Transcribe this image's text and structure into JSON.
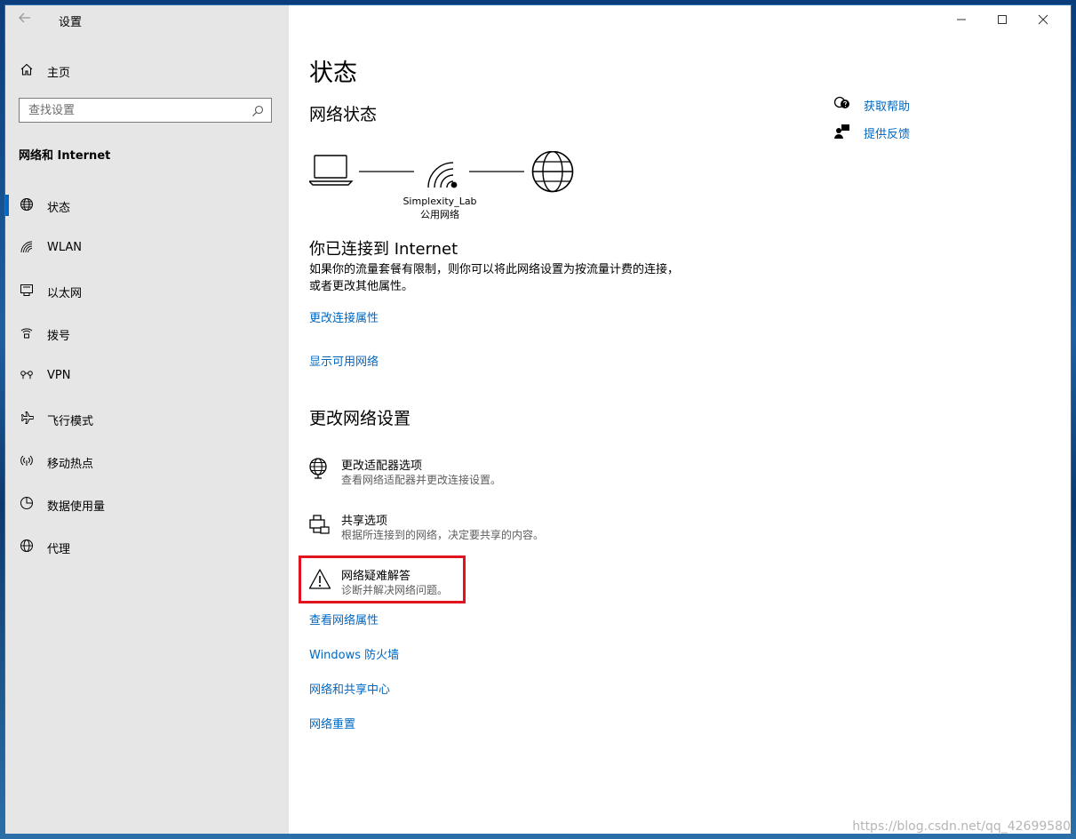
{
  "window": {
    "title": "设置"
  },
  "sidebar": {
    "home_label": "主页",
    "search_placeholder": "查找设置",
    "section_title": "网络和 Internet",
    "items": [
      {
        "label": "状态",
        "icon": "globe-icon",
        "active": true
      },
      {
        "label": "WLAN",
        "icon": "wifi-icon"
      },
      {
        "label": "以太网",
        "icon": "ethernet-icon"
      },
      {
        "label": "拨号",
        "icon": "dialup-icon"
      },
      {
        "label": "VPN",
        "icon": "vpn-icon"
      },
      {
        "label": "飞行模式",
        "icon": "airplane-icon"
      },
      {
        "label": "移动热点",
        "icon": "hotspot-icon"
      },
      {
        "label": "数据使用量",
        "icon": "data-usage-icon"
      },
      {
        "label": "代理",
        "icon": "proxy-globe-icon"
      }
    ]
  },
  "main": {
    "page_title": "状态",
    "network_status_heading": "网络状态",
    "network_name": "Simplexity_Lab",
    "network_type": "公用网络",
    "connected_title": "你已连接到 Internet",
    "connected_desc": "如果你的流量套餐有限制，则你可以将此网络设置为按流量计费的连接，或者更改其他属性。",
    "link_change_props": "更改连接属性",
    "link_show_networks": "显示可用网络",
    "change_settings_heading": "更改网络设置",
    "options": [
      {
        "title": "更改适配器选项",
        "subtitle": "查看网络适配器并更改连接设置。",
        "icon": "adapter-icon"
      },
      {
        "title": "共享选项",
        "subtitle": "根据所连接到的网络，决定要共享的内容。",
        "icon": "sharing-icon"
      },
      {
        "title": "网络疑难解答",
        "subtitle": "诊断并解决网络问题。",
        "icon": "warning-icon"
      }
    ],
    "links": [
      "查看网络属性",
      "Windows 防火墙",
      "网络和共享中心",
      "网络重置"
    ],
    "help": [
      {
        "label": "获取帮助",
        "icon": "help-chat-icon"
      },
      {
        "label": "提供反馈",
        "icon": "feedback-icon"
      }
    ]
  },
  "watermark": "https://blog.csdn.net/qq_42699580",
  "colors": {
    "accent": "#0067c0",
    "sidebar_bg": "#e6e6e6",
    "highlight": "#e0141e"
  }
}
